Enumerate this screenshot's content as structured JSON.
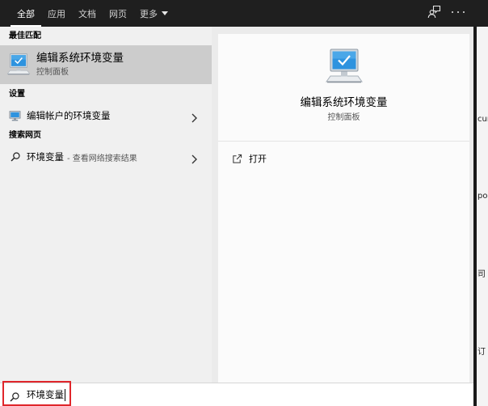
{
  "topbar": {
    "tabs": [
      {
        "label": "全部"
      },
      {
        "label": "应用"
      },
      {
        "label": "文档"
      },
      {
        "label": "网页"
      },
      {
        "label": "更多",
        "icon": "chevron-down-icon"
      }
    ],
    "active_tab_index": 0,
    "right_icons": [
      "feedback-icon",
      "more-options-icon"
    ]
  },
  "results": {
    "best_match": {
      "heading": "最佳匹配",
      "title": "编辑系统环境变量",
      "subtitle": "控制面板",
      "icon": "system-properties-icon",
      "selected": true
    },
    "settings": {
      "heading": "设置",
      "items": [
        {
          "label": "编辑帐户的环境变量",
          "icon": "monitor-icon",
          "arrow": "chevron-right-icon"
        }
      ]
    },
    "web": {
      "heading": "搜索网页",
      "items": [
        {
          "query": "环境变量",
          "suffix": "- 查看网络搜索结果",
          "icon": "search-icon",
          "arrow": "chevron-right-icon"
        }
      ]
    }
  },
  "preview": {
    "icon": "system-properties-icon",
    "title": "编辑系统环境变量",
    "subtitle": "控制面板",
    "actions": [
      {
        "label": "打开",
        "icon": "open-icon"
      }
    ]
  },
  "search_box": {
    "value": "环境变量",
    "icon": "search-icon",
    "highlighted": true
  },
  "background_window": {
    "fragments": [
      "cure",
      "pora",
      "司",
      "订"
    ]
  },
  "colors": {
    "topbar_bg": "#1f1f1f",
    "highlight": "#cccccc",
    "icon_blue": "#2e93df",
    "annotation_red": "#e0262b"
  }
}
